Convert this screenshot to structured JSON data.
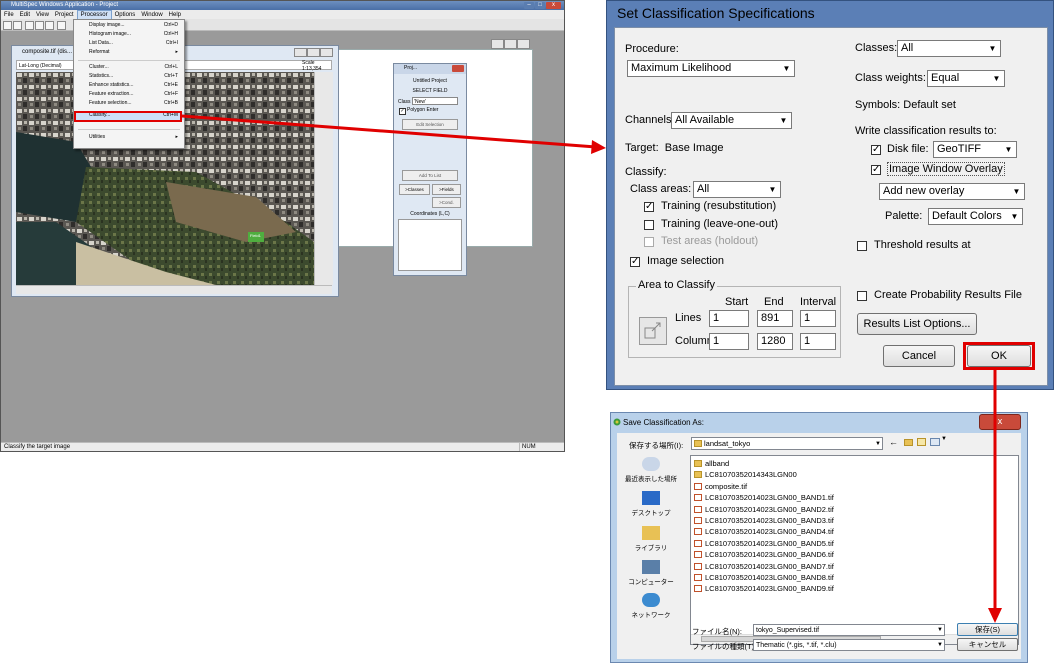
{
  "multispec": {
    "title": "MultiSpec Windows Application - Project",
    "menubar": [
      "File",
      "Edit",
      "View",
      "Project",
      "Processor",
      "Options",
      "Window",
      "Help"
    ],
    "status_text": "Classify the target image",
    "status_num": "NUM",
    "processor_menu": [
      {
        "label": "Display image...",
        "key": "Ctrl+D"
      },
      {
        "label": "Histogram image...",
        "key": "Ctrl+H"
      },
      {
        "label": "List Data...",
        "key": "Ctrl+I"
      },
      {
        "label": "Reformat",
        "key": "▸"
      },
      {
        "label": "Cluster...",
        "key": "Ctrl+L"
      },
      {
        "label": "Statistics...",
        "key": "Ctrl+T"
      },
      {
        "label": "Enhance statistics...",
        "key": "Ctrl+E"
      },
      {
        "label": "Feature extraction...",
        "key": "Ctrl+F"
      },
      {
        "label": "Feature selection...",
        "key": "Ctrl+B"
      },
      {
        "label": "Classify...",
        "key": "Ctrl+M"
      },
      {
        "label": "Utilities",
        "key": "▸"
      }
    ],
    "image_window": {
      "title": "composite.tif (dis...",
      "coord_mode": "Lat-Long (Decimal)",
      "scale_label": "Scale",
      "scale_value": "1:13,354",
      "field_label": "Field1"
    },
    "project_window": {
      "title": "Proj...",
      "heading": "Untitled Project",
      "select_field": "SELECT FIELD",
      "class_label": "Class",
      "class_value": "'New'",
      "polygon_enter": "Polygon Enter",
      "edit_selection": "Edit Selection",
      "add_to_list": "Add To List",
      "classes_btn": ">Classes",
      "fields_btn": ">Fields",
      "cond_btn": ">Cond.",
      "coordinates": "Coordinates (L,C)"
    }
  },
  "classification_dialog": {
    "title": "Set Classification Specifications",
    "procedure_label": "Procedure:",
    "procedure_value": "Maximum Likelihood",
    "channels_label": "Channels:",
    "channels_value": "All Available",
    "target_label": "Target:",
    "target_value": "Base Image",
    "classify_label": "Classify:",
    "class_areas_label": "Class areas:",
    "class_areas_value": "All",
    "training_resub": "Training (resubstitution)",
    "training_loo": "Training (leave-one-out)",
    "test_areas": "Test areas (holdout)",
    "image_selection": "Image selection",
    "area_group": "Area to Classify",
    "start_label": "Start",
    "end_label": "End",
    "interval_label": "Interval",
    "lines_label": "Lines",
    "columns_label": "Columns",
    "lines_start": "1",
    "lines_end": "891",
    "lines_interval": "1",
    "columns_start": "1",
    "columns_end": "1280",
    "columns_interval": "1",
    "classes_label": "Classes:",
    "classes_value": "All",
    "class_weights_label": "Class weights:",
    "class_weights_value": "Equal",
    "symbols_text": "Symbols:  Default set",
    "write_results_label": "Write classification results to:",
    "disk_file_label": "Disk file:",
    "disk_file_value": "GeoTIFF",
    "image_window_overlay": "Image Window Overlay",
    "overlay_value": "Add new overlay",
    "palette_label": "Palette:",
    "palette_value": "Default Colors",
    "threshold_label": "Threshold results at",
    "probability_label": "Create Probability Results File",
    "results_list_btn": "Results List Options...",
    "cancel_btn": "Cancel",
    "ok_btn": "OK"
  },
  "save_dialog": {
    "title": "Save Classification As:",
    "save_in_label": "保存する場所(I):",
    "save_in_value": "landsat_tokyo",
    "places": [
      "最近表示した場所",
      "デスクトップ",
      "ライブラリ",
      "コンピューター",
      "ネットワーク"
    ],
    "files_col1": [
      {
        "name": "allband",
        "type": "folder"
      },
      {
        "name": "LC81070352014343LGN00",
        "type": "folder"
      },
      {
        "name": "composite.tif",
        "type": "file"
      },
      {
        "name": "LC81070352014023LGN00_BAND1.tif",
        "type": "file"
      },
      {
        "name": "LC81070352014023LGN00_BAND2.tif",
        "type": "file"
      },
      {
        "name": "LC81070352014023LGN00_BAND3.tif",
        "type": "file"
      },
      {
        "name": "LC81070352014023LGN00_BAND4.tif",
        "type": "file"
      },
      {
        "name": "LC81070352014023LGN00_BAND5.tif",
        "type": "file"
      },
      {
        "name": "LC81070352014023LGN00_BAND6.tif",
        "type": "file"
      },
      {
        "name": "LC81070352014023LGN00_BAND7.tif",
        "type": "file"
      },
      {
        "name": "LC81070352014023LGN00_BAND8.tif",
        "type": "file"
      },
      {
        "name": "LC81070352014023LGN00_BAND9.tif",
        "type": "file"
      }
    ],
    "files_col2": [
      {
        "name": "LC81070352014023LGN00_BAND10.tif",
        "type": "file"
      },
      {
        "name": "LC81070352014023LGN00_BAND11.tif",
        "type": "file"
      },
      {
        "name": "LC81070352014023LGN00_BANDQA.tif",
        "type": "file"
      },
      {
        "name": "test.tif",
        "type": "file"
      },
      {
        "name": "tokyo_NDVI.tif",
        "type": "file"
      },
      {
        "name": "tokyo_Unsupervised.tif",
        "type": "file"
      },
      {
        "name": "tokyo_Unsupervised2.tif",
        "type": "file"
      }
    ],
    "filename_label": "ファイル名(N):",
    "filename_value": "tokyo_Supervised.tif",
    "filetype_label": "ファイルの種類(T):",
    "filetype_value": "Thematic (*.gis, *.tif, *.clu)",
    "save_btn": "保存(S)",
    "cancel_btn": "キャンセル"
  },
  "colors": {
    "highlight": "#e00000",
    "dialog_frame": "#5b7fb6",
    "save_frame": "#b9d1ea"
  }
}
